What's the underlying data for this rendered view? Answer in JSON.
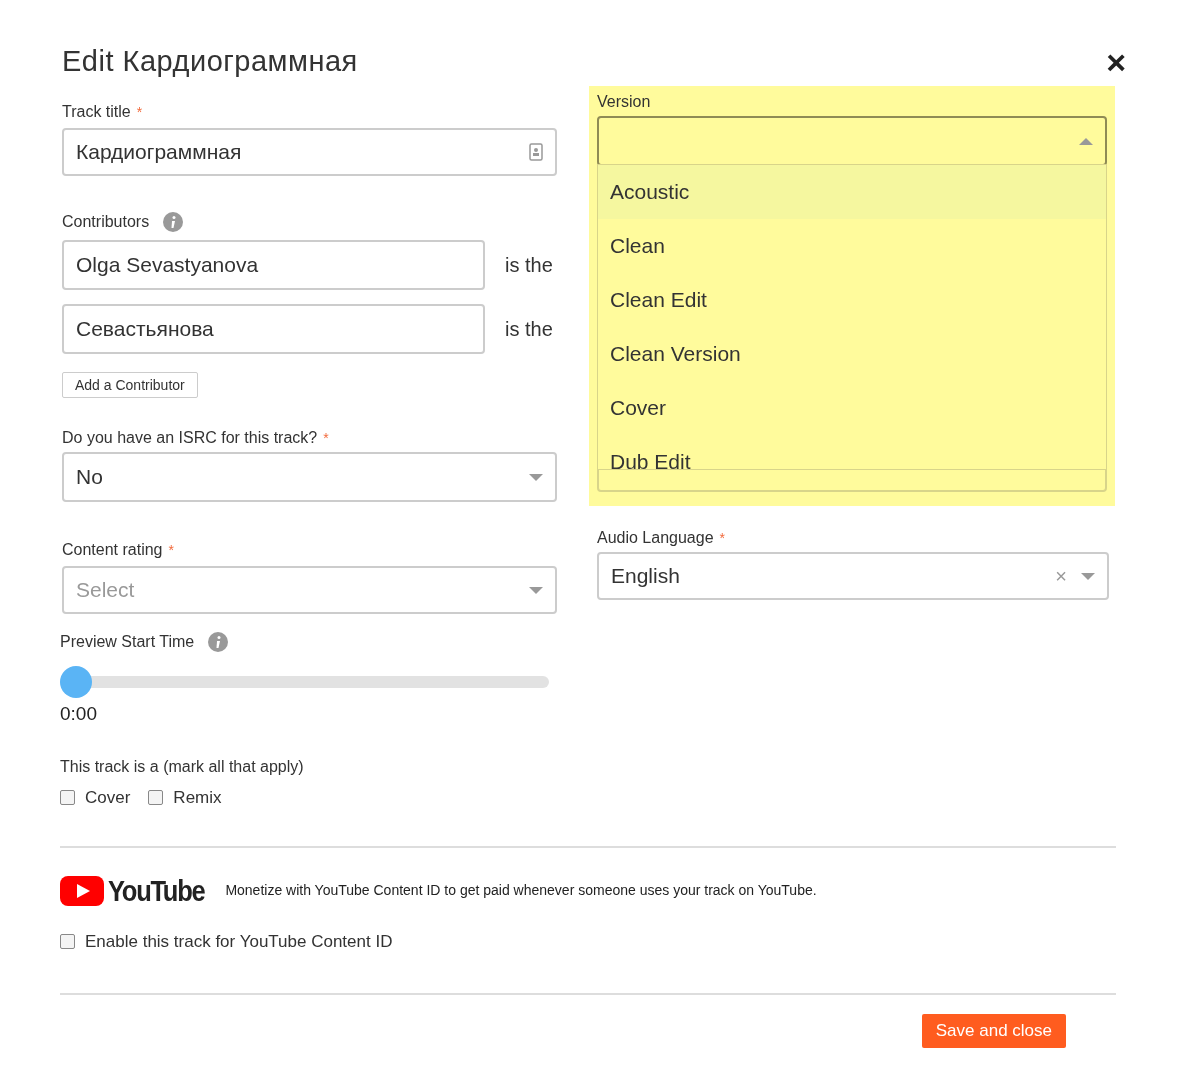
{
  "dialog": {
    "title": "Edit Кардиограммная",
    "close": "×"
  },
  "track_title": {
    "label": "Track title",
    "required_mark": "*",
    "value": "Кардиограммная"
  },
  "contributors": {
    "label": "Contributors",
    "rows": [
      {
        "name": "Olga Sevastyanova",
        "role_text": "is the"
      },
      {
        "name": "Севастьянова",
        "role_text": "is the"
      }
    ],
    "add_button": "Add a Contributor"
  },
  "isrc": {
    "label": "Do you have an ISRC for this track?",
    "required_mark": "*",
    "value": "No"
  },
  "content_rating": {
    "label": "Content rating",
    "required_mark": "*",
    "placeholder": "Select"
  },
  "preview": {
    "label": "Preview Start Time",
    "level": 0,
    "time": "0:00"
  },
  "track_type": {
    "label": "This track is a (mark all that apply)",
    "options": [
      {
        "label": "Cover",
        "checked": false
      },
      {
        "label": "Remix",
        "checked": false
      }
    ]
  },
  "version": {
    "label": "Version",
    "expanded": true,
    "options": [
      {
        "label": "Acoustic",
        "selected": true
      },
      {
        "label": "Clean",
        "selected": false
      },
      {
        "label": "Clean Edit",
        "selected": false
      },
      {
        "label": "Clean Version",
        "selected": false
      },
      {
        "label": "Cover",
        "selected": false
      },
      {
        "label": "Dub Edit",
        "selected": false
      }
    ]
  },
  "audio_language": {
    "label": "Audio Language",
    "required_mark": "*",
    "value": "English",
    "clear": "×"
  },
  "youtube": {
    "logo_text": "YouTube",
    "text": "Monetize with YouTube Content ID to get paid whenever someone uses your track on YouTube.",
    "enable": {
      "label": "Enable this track for YouTube Content ID",
      "checked": false
    }
  },
  "save_button": "Save and close"
}
